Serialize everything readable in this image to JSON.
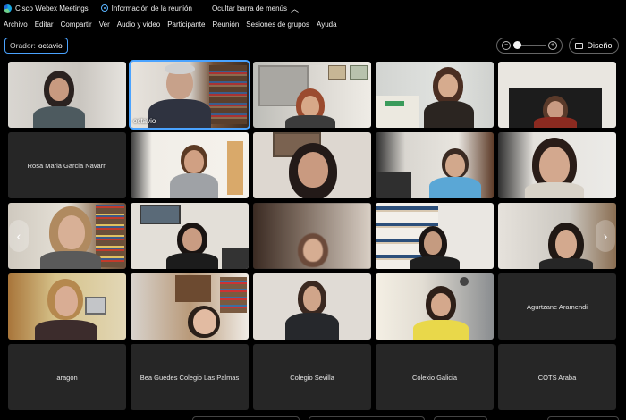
{
  "titlebar": {
    "app_name": "Cisco Webex Meetings",
    "meeting_info": "Información de la reunión",
    "hide_menu": "Ocultar barra de menús"
  },
  "menu": [
    "Archivo",
    "Editar",
    "Compartir",
    "Ver",
    "Audio y vídeo",
    "Participante",
    "Reunión",
    "Sesiones de grupos",
    "Ayuda"
  ],
  "toolbar": {
    "speaker_label": "Orador:",
    "speaker_name": "octavio",
    "layout_label": "Diseño",
    "zoom_out": "−",
    "zoom_in": "+",
    "zoom_level": 0.0
  },
  "tiles": {
    "octavio": "octavio",
    "rosa": "Rosa Maria Garcia Navarri",
    "agurtzane": "Agurtzane Aramendi",
    "aragon": "aragon",
    "bea": "Bea Guedes Colegio Las Palmas",
    "sevilla": "Colegio Sevilla",
    "galicia": "Colexio Galicia",
    "cots": "COTS Araba"
  },
  "nav": {
    "prev": "‹",
    "next": "›"
  }
}
